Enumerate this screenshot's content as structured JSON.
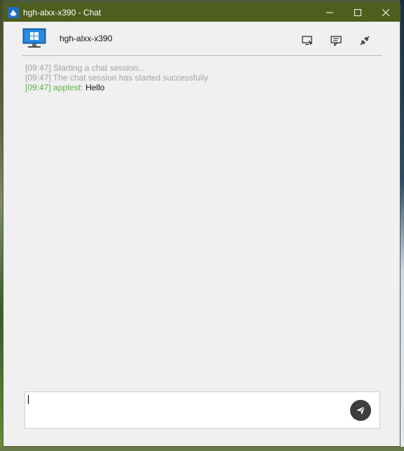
{
  "window": {
    "title": "hgh-alxx-x390 - Chat",
    "controls": [
      "minimize-icon",
      "maximize-icon",
      "close-icon"
    ]
  },
  "header": {
    "host_name": "hgh-alxx-x390",
    "icons": [
      "monitor-icon",
      "remote-control-icon",
      "chat-icon",
      "disconnect-icon"
    ]
  },
  "messages": [
    {
      "time": "[09:47]",
      "sender": "",
      "text": "Starting a chat session..."
    },
    {
      "time": "[09:47]",
      "sender": "",
      "text": "The chat session has started successfully."
    },
    {
      "time": "[09:47]",
      "sender": "apptest:",
      "text": "Hello"
    }
  ],
  "input": {
    "value": "",
    "send_icon": "send-icon"
  },
  "colors": {
    "titlebar": "#4f5d1f",
    "system_text": "#a3a3a3",
    "sender": "#5fb049",
    "send_button": "#3d3d3d"
  }
}
